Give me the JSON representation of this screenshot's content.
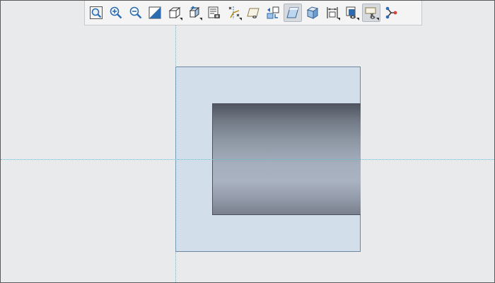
{
  "toolbar": {
    "buttons": [
      {
        "id": "refit",
        "icon": "refit-icon",
        "active": false,
        "dropdown": false
      },
      {
        "id": "zoom-in",
        "icon": "zoom-in-icon",
        "active": false,
        "dropdown": false
      },
      {
        "id": "zoom-out",
        "icon": "zoom-out-icon",
        "active": false,
        "dropdown": false
      },
      {
        "id": "repaint",
        "icon": "repaint-icon",
        "active": false,
        "dropdown": false
      },
      {
        "id": "display-style",
        "icon": "shaded-cube-icon",
        "active": false,
        "dropdown": true
      },
      {
        "id": "saved-orientations",
        "icon": "saved-view-icon",
        "active": false,
        "dropdown": true
      },
      {
        "id": "view-manager",
        "icon": "view-manager-icon",
        "active": false,
        "dropdown": false
      },
      {
        "id": "datum-display",
        "icon": "datum-display-icon",
        "active": false,
        "dropdown": true
      },
      {
        "id": "annotation-display",
        "icon": "annotation-plane-icon",
        "active": false,
        "dropdown": false
      },
      {
        "id": "spin-center",
        "icon": "spin-center-icon",
        "active": false,
        "dropdown": false
      },
      {
        "id": "sketch-view",
        "icon": "sketch-view-icon",
        "active": true,
        "dropdown": false
      },
      {
        "id": "perspective",
        "icon": "perspective-cube-icon",
        "active": false,
        "dropdown": false
      },
      {
        "id": "dimension-display",
        "icon": "dimension-display-icon",
        "active": false,
        "dropdown": true
      },
      {
        "id": "appearance",
        "icon": "appearance-icon",
        "active": false,
        "dropdown": true
      },
      {
        "id": "sketcher-display",
        "icon": "sketcher-display-icon",
        "active": true,
        "dropdown": true
      },
      {
        "id": "constraints",
        "icon": "branch-icon",
        "active": false,
        "dropdown": false
      }
    ]
  },
  "colors": {
    "background": "#e9eaec",
    "sketch_plane": "#d3deeb",
    "axis": "#7fb2c4",
    "icon_blue": "#2b6cb0"
  }
}
